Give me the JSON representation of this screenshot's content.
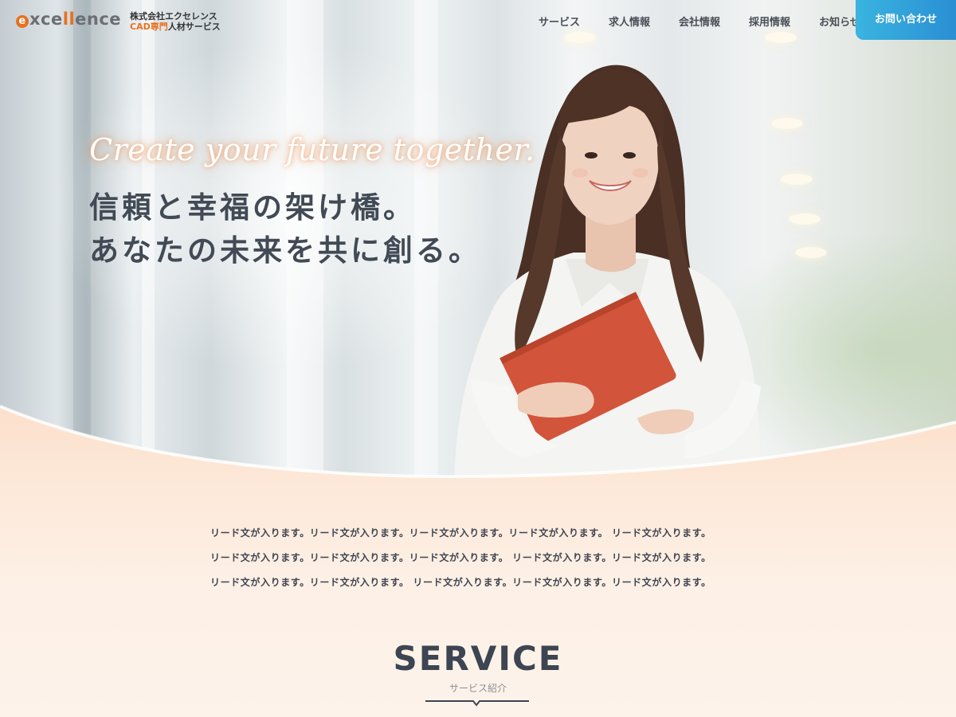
{
  "brand": {
    "logo_text_pre": "xce",
    "logo_text_accent": "ll",
    "logo_text_post": "ence",
    "logo_mark": "e",
    "company_name": "株式会社エクセレンス",
    "company_sub_highlight": "CAD専門",
    "company_sub_rest": "人材サービス",
    "accent_color": "#e8701e"
  },
  "nav": {
    "items": [
      {
        "label": "サービス"
      },
      {
        "label": "求人情報"
      },
      {
        "label": "会社情報"
      },
      {
        "label": "採用情報"
      },
      {
        "label": "お知らせ"
      }
    ],
    "contact_label": "お問い合わせ",
    "contact_color": "#2a9fd8"
  },
  "hero": {
    "tagline": "Create your future together.",
    "headline_line1": "信頼と幸福の架け橋。",
    "headline_line2": "あなたの未来を共に創る。"
  },
  "lead": {
    "lines": [
      "リード文が入ります。リード文が入ります。リード文が入ります。リード文が入ります。 リード文が入ります。",
      "リード文が入ります。リード文が入ります。リード文が入ります。 リード文が入ります。リード文が入ります。",
      "リード文が入ります。リード文が入ります。 リード文が入ります。リード文が入ります。リード文が入ります。"
    ]
  },
  "service": {
    "title": "SERVICE",
    "subtitle": "サービス紹介"
  }
}
